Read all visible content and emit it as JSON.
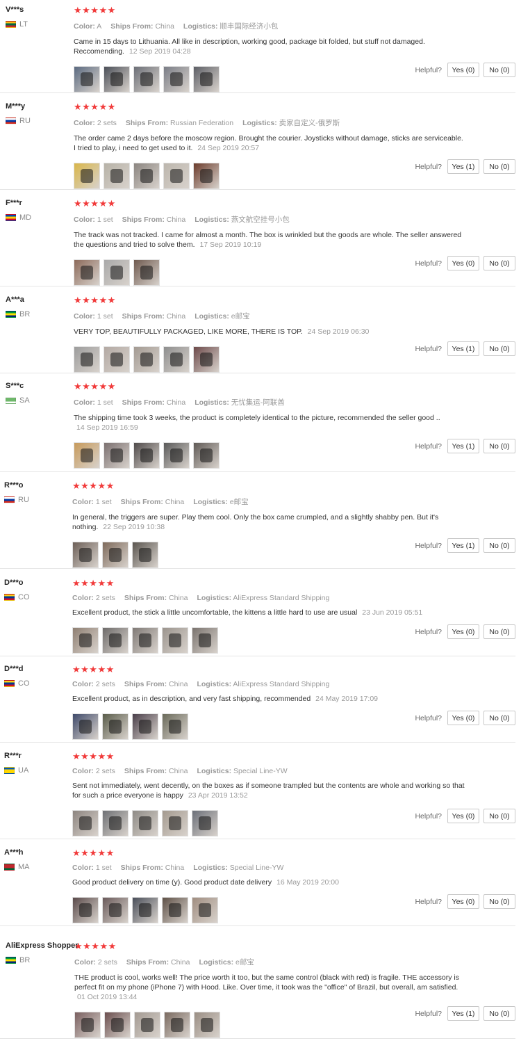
{
  "labels": {
    "color": "Color:",
    "ships_from": "Ships From:",
    "logistics": "Logistics:",
    "helpful": "Helpful?"
  },
  "stars_glyph": "★★★★★",
  "reviews": [
    {
      "user": "V***s",
      "country": "LT",
      "flag": [
        "#fdb913",
        "#006a44",
        "#c1272d"
      ],
      "color": "A",
      "ships_from": "China",
      "logistics": "顺丰国际经济小包",
      "text": "Came in 15 days to Lithuania. All like in description, working good, package bit folded, but stuff not damaged. Reccomending.",
      "date": "12 Sep 2019 04:28",
      "yes": "Yes (0)",
      "no": "No (0)",
      "photos": [
        "#5b6a80",
        "#4b4f58",
        "#6c6f77",
        "#7a7d86",
        "#5d5f66"
      ]
    },
    {
      "user": "M***y",
      "country": "RU",
      "flag": [
        "#ffffff",
        "#0039a6",
        "#d52b1e"
      ],
      "color": "2 sets",
      "ships_from": "Russian Federation",
      "logistics": "卖家自定义-俄罗斯",
      "text": "The order came 2 days before the moscow region. Brought the courier. Joysticks without damage, sticks are serviceable. I tried to play, i need to get used to it.",
      "date": "24 Sep 2019 20:57",
      "yes": "Yes (1)",
      "no": "No (0)",
      "photos": [
        "#d9b64a",
        "#b7b2a7",
        "#8b8580",
        "#bcb6ad",
        "#6b3b2b"
      ]
    },
    {
      "user": "F***r",
      "country": "MD",
      "flag": [
        "#0046ae",
        "#ffd200",
        "#cc092f"
      ],
      "color": "1 set",
      "ships_from": "China",
      "logistics": "燕文航空挂号小包",
      "text": "The track was not tracked. I came for almost a month. The box is wrinkled but the goods are whole. The seller answered the questions and tried to solve them.",
      "date": "17 Sep 2019 10:19",
      "yes": "Yes (0)",
      "no": "No (0)",
      "photos": [
        "#8c6a5a",
        "#a9a9a9",
        "#6f5a4f"
      ]
    },
    {
      "user": "A***a",
      "country": "BR",
      "flag": [
        "#009c3b",
        "#ffdf00",
        "#002776"
      ],
      "color": "1 set",
      "ships_from": "China",
      "logistics": "e邮宝",
      "text": "VERY TOP, BEAUTIFULLY PACKAGED, LIKE MORE, THERE IS TOP.",
      "date": "24 Sep 2019 06:30",
      "yes": "Yes (1)",
      "no": "No (0)",
      "photos": [
        "#9c9c9c",
        "#b3a9a3",
        "#a39a92",
        "#8e8e8e",
        "#6d4a4a"
      ]
    },
    {
      "user": "S***c",
      "country": "SA",
      "flag": [
        "#6fb86b",
        "#6fb86b",
        "#ffffff"
      ],
      "color": "1 set",
      "ships_from": "China",
      "logistics": "无忧集运-阿联酋",
      "text": "The shipping time took 3 weeks, the product is completely identical to the picture, recommended the seller good ..",
      "date": "14 Sep 2019 16:59",
      "yes": "Yes (1)",
      "no": "No (0)",
      "photos": [
        "#c79a5b",
        "#7b7070",
        "#4f4a4a",
        "#5a5a5a",
        "#605a56"
      ]
    },
    {
      "user": "R***o",
      "country": "RU",
      "flag": [
        "#ffffff",
        "#0039a6",
        "#d52b1e"
      ],
      "color": "1 set",
      "ships_from": "China",
      "logistics": "e邮宝",
      "text": "In general, the triggers are super. Play them cool. Only the box came crumpled, and a slightly shabby pen. But it's nothing.",
      "date": "22 Sep 2019 10:38",
      "yes": "Yes (1)",
      "no": "No (0)",
      "photos": [
        "#6d6058",
        "#7e6a5b",
        "#5b5650"
      ]
    },
    {
      "user": "D***o",
      "country": "CO",
      "flag": [
        "#fcd116",
        "#003893",
        "#ce1126"
      ],
      "color": "2 sets",
      "ships_from": "China",
      "logistics": "AliExpress Standard Shipping",
      "text": "Excellent product, the stick a little uncomfortable, the kittens a little hard to use are usual",
      "date": "23 Jun 2019 05:51",
      "yes": "Yes (0)",
      "no": "No (0)",
      "photos": [
        "#8f7f72",
        "#6e6b6a",
        "#807a76",
        "#9b948d",
        "#7a736e"
      ]
    },
    {
      "user": "D***d",
      "country": "CO",
      "flag": [
        "#fcd116",
        "#003893",
        "#ce1126"
      ],
      "color": "2 sets",
      "ships_from": "China",
      "logistics": "AliExpress Standard Shipping",
      "text": "Excellent product, as in description, and very fast shipping, recommended",
      "date": "24 May 2019 17:09",
      "yes": "Yes (0)",
      "no": "No (0)",
      "photos": [
        "#3f4a6a",
        "#5a5c4a",
        "#4a3f4a",
        "#6a6a5a"
      ]
    },
    {
      "user": "R***r",
      "country": "UA",
      "flag": [
        "#0057b7",
        "#ffd700",
        "#ffd700"
      ],
      "color": "2 sets",
      "ships_from": "China",
      "logistics": "Special Line-YW",
      "text": "Sent not immediately, went decently, on the boxes as if someone trampled but the contents are whole and working so that for such a price everyone is happy",
      "date": "23 Apr 2019 13:52",
      "yes": "Yes (0)",
      "no": "No (0)",
      "photos": [
        "#8d8580",
        "#6f7175",
        "#8f8b86",
        "#a49a8f",
        "#6c7079"
      ]
    },
    {
      "user": "A***h",
      "country": "MA",
      "flag": [
        "#c1272d",
        "#c1272d",
        "#006233"
      ],
      "color": "1 set",
      "ships_from": "China",
      "logistics": "Special Line-YW",
      "text": "Good product delivery on time (y). Good product date delivery",
      "date": "16 May 2019 20:00",
      "yes": "Yes (0)",
      "no": "No (0)",
      "photos": [
        "#5a4a4a",
        "#6a5a5a",
        "#4a4f5a",
        "#5f5147",
        "#a08d80"
      ]
    },
    {
      "user": "AliExpress Shopper",
      "country": "BR",
      "flag": [
        "#009c3b",
        "#ffdf00",
        "#002776"
      ],
      "color": "2 sets",
      "ships_from": "China",
      "logistics": "e邮宝",
      "text": "THE product is cool, works well! The price worth it too, but the same control (black with red) is fragile. THE accessory is perfect fit on my phone (iPhone 7) with Hood. Like. Over time, it took was the \"office\" of Brazil, but overall, am satisfied.",
      "date": "01 Oct 2019 13:44",
      "yes": "Yes (1)",
      "no": "No (0)",
      "photos": [
        "#7a6060",
        "#6b4f4f",
        "#a39a92",
        "#7a6a60",
        "#9a8e84"
      ]
    }
  ]
}
